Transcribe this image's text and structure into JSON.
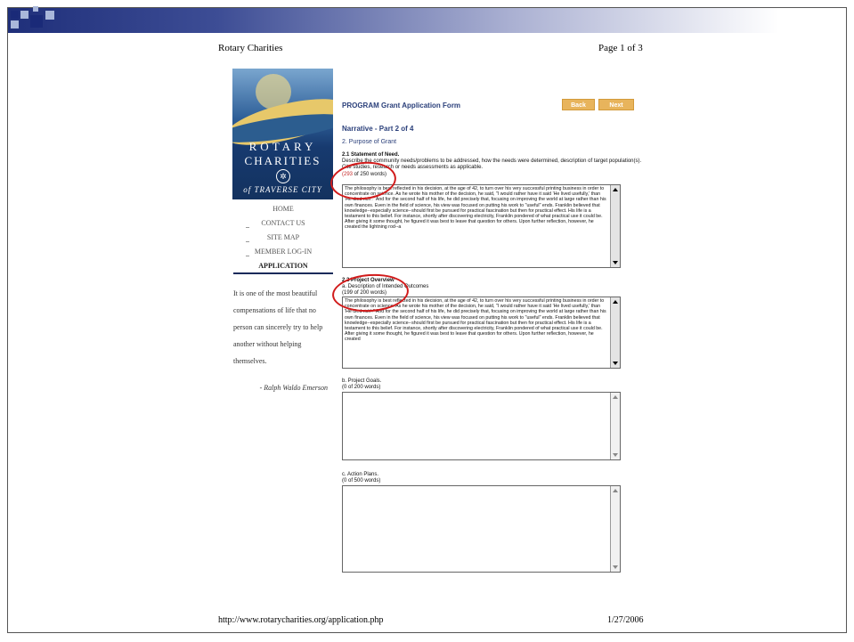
{
  "print_header": {
    "site": "Rotary Charities",
    "page": "Page 1 of 3"
  },
  "print_footer": {
    "url": "http://www.rotarycharities.org/application.php",
    "date": "1/27/2006"
  },
  "logo": {
    "line1": "ROTARY",
    "line2": "CHARITIES",
    "line3": "of TRAVERSE CITY"
  },
  "nav": [
    "HOME",
    "CONTACT US",
    "SITE MAP",
    "MEMBER LOG-IN",
    "APPLICATION"
  ],
  "quote": {
    "text": "It is one of the most beautiful compensations of life that no person can sincerely try to help another without helping themselves.",
    "author": "- Ralph Waldo Emerson"
  },
  "form": {
    "title": "PROGRAM Grant Application Form",
    "back_label": "Back",
    "next_label": "Next",
    "section_title": "Narrative - Part 2 of 4",
    "subsection": "2. Purpose of Grant",
    "q21_title": "2.1 Statement of Need.",
    "q21_desc": "Describe the community needs/problems to be addressed, how the needs were determined, description of target population(s). Cite studies, research or needs assessments as applicable.",
    "q21_count_num": "(293",
    "q21_count_rest": " of 250 words)",
    "q21_text": "The philosophy is best reflected in his decision, at the age of 42, to turn over his very successful printing business in order to concentrate on science. As he wrote his mother of the decision, he said, \"I would rather have it said 'He lived usefully,' than 'He died rich'.\" And for the second half of his life, he did precisely that, focusing on improving the world at large rather than his own finances. Even in the field of science, his view was focused on putting his work to \"useful\" ends. Franklin believed that knowledge--especially science--should first be pursued for practical fascination but then for practical effect. His life is a testament to this belief. For instance, shortly after discovering electricity, Franklin pondered of what practical use it could be. After giving it some thought, he figured it was best to leave that question for others. Upon further reflection, however, he created the lightning rod--a",
    "q22_title": "2.2 Project Overview",
    "q22a_label": "a. Description of Intended Outcomes",
    "q22a_count": "(199 of 200 words)",
    "q22a_text": "The philosophy is best reflected in his decision, at the age of 42, to turn over his very successful printing business in order to concentrate on science. As he wrote his mother of the decision, he said, \"I would rather have it said 'He lived usefully,' than 'He died rich'.\" And for the second half of his life, he did precisely that, focusing on improving the world at large rather than his own finances. Even in the field of science, his view was focused on putting his work to \"useful\" ends. Franklin believed that knowledge--especially science--should first be pursued for practical fascination but then for practical effect. His life is a testament to this belief. For instance, shortly after discovering electricity, Franklin pondered of what practical use it could be. After giving it some thought, he figured it was best to leave that question for others. Upon further reflection, however, he created",
    "q22b_label": "b. Project Goals.",
    "q22b_count": "(0 of 200 words)",
    "q22c_label": "c. Action Plans.",
    "q22c_count": "(0 of 500 words)"
  }
}
